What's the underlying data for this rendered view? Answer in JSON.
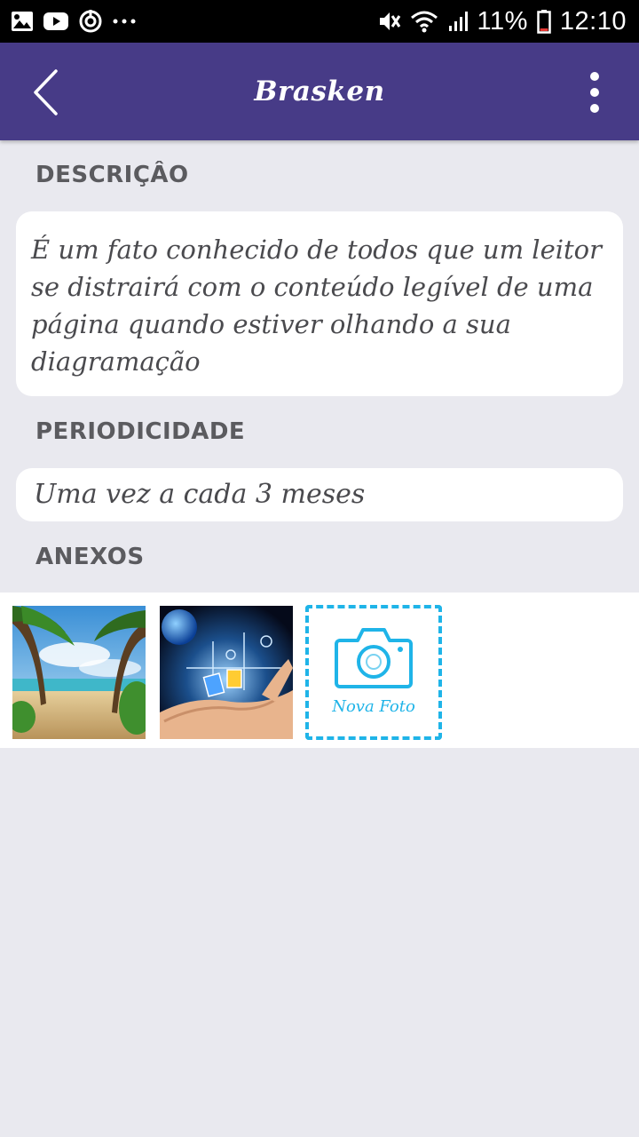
{
  "status_bar": {
    "battery": "11%",
    "time": "12:10"
  },
  "app_bar": {
    "title": "Brasken",
    "back_icon": "chevron-left-icon",
    "menu_icon": "more-vertical-icon"
  },
  "description": {
    "label": "DESCRIÇÂO",
    "text": "É um fato conhecido de todos que um leitor se distrairá com o conteúdo legível de uma página quando estiver olhando a sua diagramação"
  },
  "periodicity": {
    "label": "PERIODICIDADE",
    "value": "Uma vez a cada 3 meses"
  },
  "attachments": {
    "label": "ANEXOS",
    "items": [
      {
        "name": "beach-photo"
      },
      {
        "name": "technology-photo"
      }
    ],
    "new_photo_label": "Nova Foto",
    "new_photo_icon": "camera-icon"
  },
  "colors": {
    "app_bar": "#473b87",
    "background": "#e9e9ef",
    "accent": "#1fb4e8"
  }
}
